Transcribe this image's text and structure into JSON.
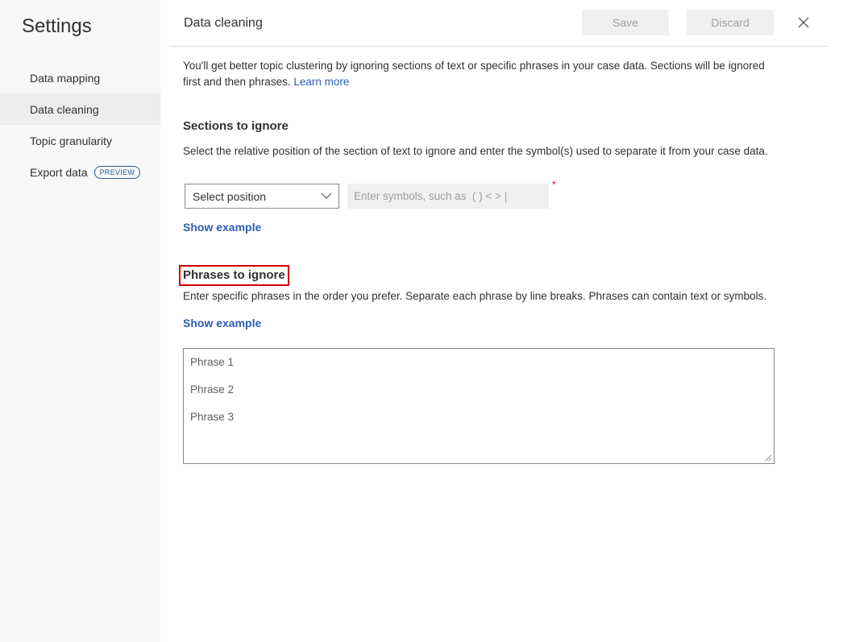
{
  "sidebar": {
    "title": "Settings",
    "items": [
      {
        "label": "Data mapping"
      },
      {
        "label": "Data cleaning",
        "active": true
      },
      {
        "label": "Topic granularity"
      },
      {
        "label": "Export data",
        "badge": "PREVIEW"
      }
    ]
  },
  "header": {
    "title": "Data cleaning",
    "save_label": "Save",
    "discard_label": "Discard",
    "close_icon": "close-icon"
  },
  "intro": {
    "text": "You'll get better topic clustering by ignoring sections of text or specific phrases in your case data. Sections will be ignored first and then phrases. ",
    "link": "Learn more"
  },
  "sections": {
    "heading": "Sections to ignore",
    "description": "Select the relative position of the section of text to ignore and enter the symbol(s) used to separate it from your case data.",
    "select_value": "Select position",
    "symbols_placeholder": "Enter symbols, such as  ( ) < > |",
    "required_mark": "*",
    "show_example": "Show example"
  },
  "phrases": {
    "heading": "Phrases to ignore",
    "description": "Enter specific phrases in the order you prefer. Separate each phrase by line breaks. Phrases can contain text or symbols.",
    "show_example": "Show example",
    "lines": [
      "Phrase 1",
      "Phrase 2",
      "Phrase 3"
    ]
  },
  "colors": {
    "accent": "#2b5fb4",
    "highlight_box": "#d20000",
    "sidebar_bg": "#f8f8f8"
  }
}
